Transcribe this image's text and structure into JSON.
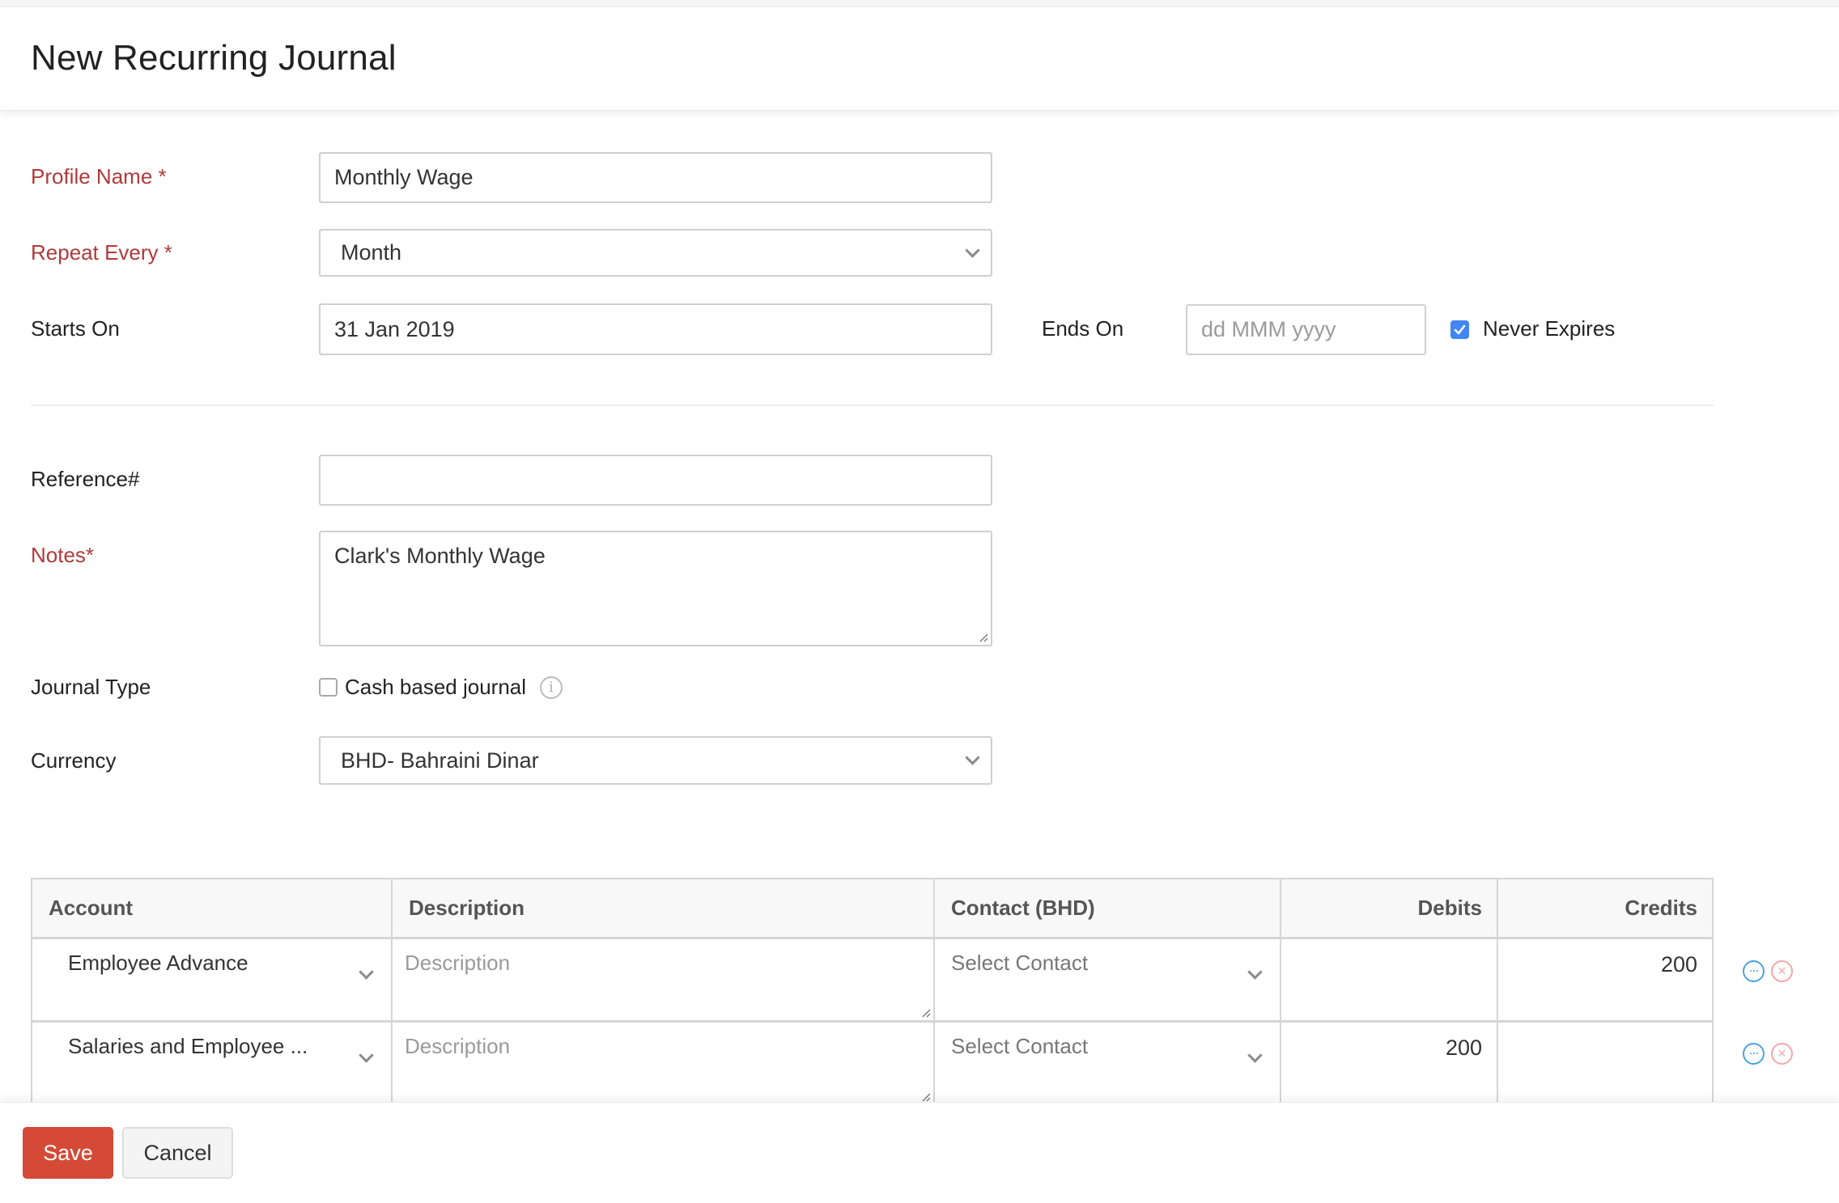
{
  "page": {
    "title": "New Recurring Journal"
  },
  "form": {
    "profile_name": {
      "label": "Profile Name *",
      "value": "Monthly Wage"
    },
    "repeat_every": {
      "label": "Repeat Every *",
      "value": "Month"
    },
    "starts_on": {
      "label": "Starts On",
      "value": "31 Jan 2019"
    },
    "ends_on": {
      "label": "Ends On",
      "placeholder": "dd MMM yyyy",
      "value": ""
    },
    "never_expires": {
      "label": "Never Expires",
      "checked": true
    },
    "reference": {
      "label": "Reference#",
      "value": ""
    },
    "notes": {
      "label": "Notes*",
      "value": "Clark's Monthly Wage"
    },
    "journal_type": {
      "label": "Journal Type",
      "option_label": "Cash based journal",
      "checked": false
    },
    "currency": {
      "label": "Currency",
      "value": "BHD- Bahraini Dinar"
    }
  },
  "table": {
    "headers": {
      "account": "Account",
      "description": "Description",
      "contact": "Contact (BHD)",
      "debits": "Debits",
      "credits": "Credits"
    },
    "rows": [
      {
        "account": "Employee Advance",
        "description_placeholder": "Description",
        "contact_placeholder": "Select Contact",
        "debits": "",
        "credits": "200"
      },
      {
        "account": "Salaries and Employee ...",
        "description_placeholder": "Description",
        "contact_placeholder": "Select Contact",
        "debits": "200",
        "credits": ""
      }
    ]
  },
  "icons": {
    "more": "…",
    "remove": "×",
    "info": "i"
  },
  "colors": {
    "required_label": "#b03a3a",
    "save_button": "#d44a37",
    "checkbox_checked": "#4285f4",
    "more_icon": "#4aa3df",
    "remove_icon": "#f3a8a8"
  },
  "footer": {
    "save_label": "Save",
    "cancel_label": "Cancel"
  }
}
